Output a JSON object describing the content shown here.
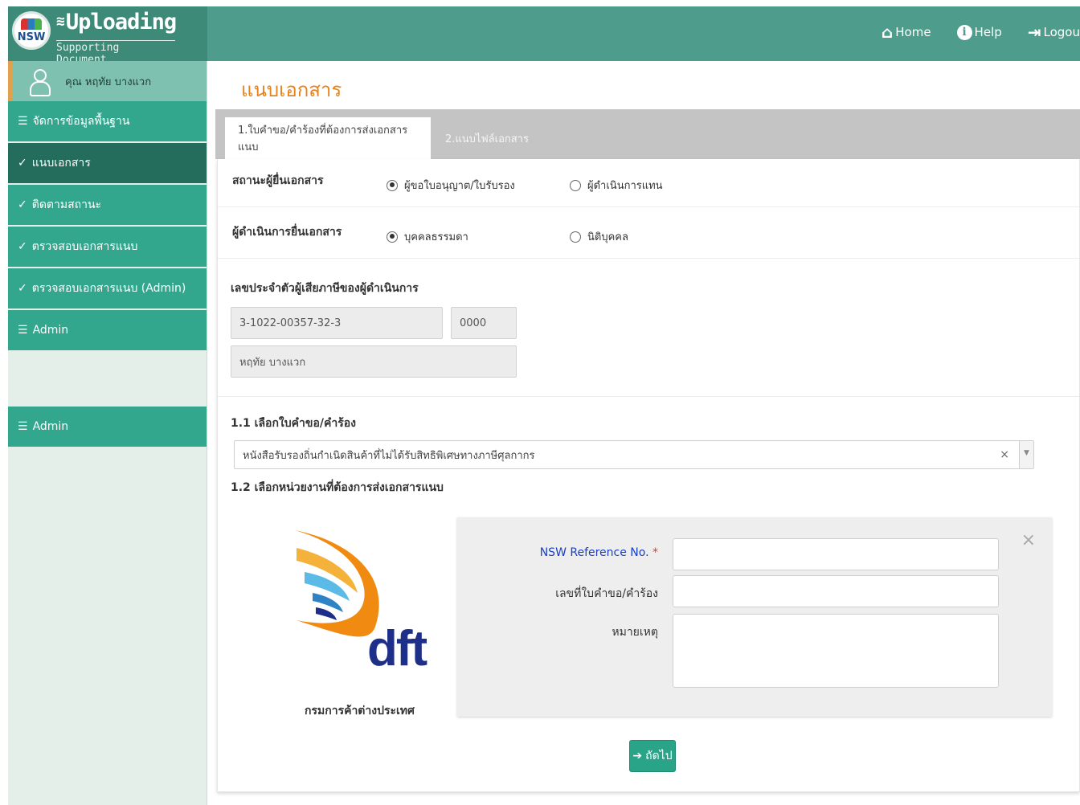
{
  "header": {
    "logo_text": "NSW",
    "app_title": "Uploading",
    "app_subtitle": "Supporting Document",
    "nav": [
      {
        "label": "Home",
        "icon": "home-icon"
      },
      {
        "label": "Help",
        "icon": "info-icon"
      },
      {
        "label": "Logou",
        "icon": "logout-icon"
      }
    ]
  },
  "sidebar": {
    "user_name": "คุณ หฤทัย บางแวก",
    "items": [
      {
        "label": "จัดการข้อมูลพื้นฐาน",
        "icon": "menu-icon"
      },
      {
        "label": "แนบเอกสาร",
        "icon": "check-circle-icon",
        "active": true
      },
      {
        "label": "ติดตามสถานะ",
        "icon": "check-circle-icon"
      },
      {
        "label": "ตรวจสอบเอกสารแนบ",
        "icon": "check-circle-icon"
      },
      {
        "label": "ตรวจสอบเอกสารแนบ (Admin)",
        "icon": "check-circle-icon"
      },
      {
        "label": "Admin",
        "icon": "menu-icon"
      }
    ],
    "bottom_item": {
      "label": "Admin",
      "icon": "menu-icon"
    }
  },
  "main": {
    "page_title": "แนบเอกสาร",
    "tabs": [
      {
        "label": "1.ใบคำขอ/คำร้องที่ต้องการส่งเอกสารแนบ",
        "active": true
      },
      {
        "label": "2.แนบไฟล์เอกสาร",
        "active": false
      }
    ],
    "submitter_status": {
      "label": "สถานะผู้ยื่นเอกสาร",
      "options": [
        "ผู้ขอใบอนุญาต/ใบรับรอง",
        "ผู้ดำเนินการแทน"
      ],
      "selected": 0
    },
    "submitter_type": {
      "label": "ผู้ดำเนินการยื่นเอกสาร",
      "options": [
        "บุคคลธรรมดา",
        "นิติบุคคล"
      ],
      "selected": 0
    },
    "taxpayer": {
      "label": "เลขประจำตัวผู้เสียภาษีของผู้ดำเนินการ",
      "tax_id": "3-1022-00357-32-3",
      "branch": "0000",
      "name": "หฤทัย บางแวก"
    },
    "section_1_1": {
      "label": "1.1 เลือกใบคำขอ/คำร้อง",
      "selected_value": "หนังสือรับรองถิ่นกำเนิดสินค้าที่ไม่ได้รับสิทธิพิเศษทางภาษีศุลกากร",
      "clear": "×",
      "arrow": "▼"
    },
    "section_1_2": {
      "label": "1.2 เลือกหน่วยงานที่ต้องการส่งเอกสารแนบ"
    },
    "agency": {
      "logo_text": "dft",
      "name": "กรมการค้าต่างประเทศ"
    },
    "form": {
      "close": "×",
      "ref_label": "NSW Reference No.",
      "required_mark": "*",
      "request_no_label": "เลขที่ใบคำขอ/คำร้อง",
      "note_label": "หมายเหตุ",
      "ref_value": "",
      "request_no_value": "",
      "note_value": ""
    },
    "next_button": "ถัดไป"
  }
}
